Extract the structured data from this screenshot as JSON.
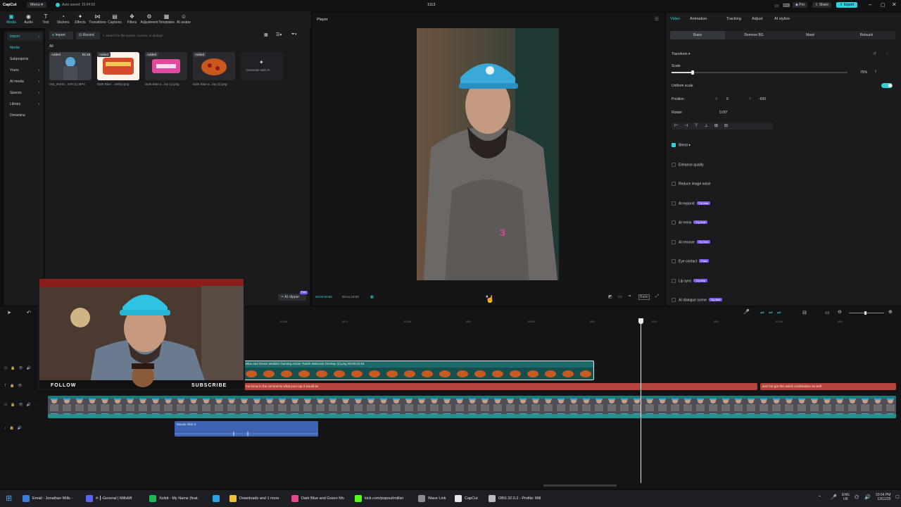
{
  "titlebar": {
    "app_name": "CapCut",
    "menu_label": "Menu",
    "autosave": "Auto saved: 15:04:02",
    "project_name": "1113",
    "pro_label": "Pro",
    "share_label": "Share",
    "export_label": "Export"
  },
  "toolbar": [
    {
      "label": "Media",
      "icon": "media-icon"
    },
    {
      "label": "Audio",
      "icon": "audio-icon"
    },
    {
      "label": "Text",
      "icon": "text-icon"
    },
    {
      "label": "Stickers",
      "icon": "stickers-icon"
    },
    {
      "label": "Effects",
      "icon": "effects-icon"
    },
    {
      "label": "Transitions",
      "icon": "transitions-icon"
    },
    {
      "label": "Captions",
      "icon": "captions-icon"
    },
    {
      "label": "Filters",
      "icon": "filters-icon"
    },
    {
      "label": "Adjustment",
      "icon": "adjustment-icon"
    },
    {
      "label": "Templates",
      "icon": "templates-icon"
    },
    {
      "label": "AI avatar",
      "icon": "ai-avatar-icon"
    }
  ],
  "leftnav": {
    "import": "Import",
    "media": "Media",
    "subprojects": "Subprojects",
    "yours": "Yours",
    "ai_media": "AI media",
    "spaces": "Spaces",
    "library": "Library",
    "dreamina": "Dreamina"
  },
  "media": {
    "import_button": "Import",
    "record_button": "Record",
    "search_placeholder": "Search for file names, scenes, or dialogs",
    "filter_all": "All",
    "items": [
      {
        "badge": "Added",
        "duration": "01:18",
        "name": "Out_20231...079 (1).MP4"
      },
      {
        "badge": "Added",
        "duration": "",
        "name": "Dark Blue ...verlay.png"
      },
      {
        "badge": "Added",
        "duration": "",
        "name": "Dark Blue a...lay (1).png"
      },
      {
        "badge": "Added",
        "duration": "",
        "name": "Dark Blue a...lay (2).png"
      }
    ],
    "generate_label": "Generate with AI",
    "ai_clipper": "AI clipper",
    "ai_clipper_badge": "Free"
  },
  "player": {
    "title": "Player",
    "current_time": "00:00:50:55",
    "total_time": "00:01:16:50",
    "overlay_number": "3",
    "ratio_label": "Ratio"
  },
  "props": {
    "tabs": [
      "Video",
      "Animation",
      "Tracking",
      "Adjust",
      "AI stylize"
    ],
    "subtabs": [
      "Basic",
      "Remove BG",
      "Mask",
      "Retouch"
    ],
    "transform": "Transform",
    "scale": "Scale",
    "scale_value": "75%",
    "scale_fraction": 0.75,
    "uniform_scale": "Uniform scale",
    "position": "Position",
    "pos_x_label": "X",
    "pos_x": "0",
    "pos_y_label": "Y",
    "pos_y": "-600",
    "rotate": "Rotate",
    "rotate_value": "0.00°",
    "blend": "Blend",
    "enhance_quality": "Enhance quality",
    "reduce_noise": "Reduce image noise",
    "ai_expand": "AI expand",
    "ai_remix": "AI remix",
    "ai_remove": "AI remove",
    "eye_contact": "Eye contact",
    "lip_sync": "Lip sync",
    "ai_dialogue": "AI dialogue scene",
    "try_free": "Try free",
    "free": "Free"
  },
  "timeline": {
    "ruler": [
      "00:40",
      "|00:f",
      "00:40",
      "|00f",
      "00:50",
      "|00f",
      "00:0",
      "|00f",
      "01:00",
      "|00f"
    ],
    "overlay_clip": "Blue and Green Modern Gaming Action Twitch Webcam Overlay (2).png  00:00:02:04",
    "caption_clip_1": "me know in the comments what your top 3 would be",
    "caption_clip_2": "and I've got this weird combination as well",
    "audio_clip": "Mouse click 4",
    "webcam_follow": "FOLLOW",
    "webcam_subscribe": "SUBSCRIBE"
  },
  "taskbar": {
    "items": [
      {
        "label": "Email - Jonathan Mills -",
        "color": "#3a7bd5"
      },
      {
        "label": "#-┃-General | MillsMf",
        "color": "#5865f2"
      },
      {
        "label": "Xzibit - My Name (feat.",
        "color": "#1db954"
      },
      {
        "label": "",
        "color": "#2aa3e0"
      },
      {
        "label": "Downloads and 1 more",
        "color": "#f0c040"
      },
      {
        "label": "Dark Blue and Green Mo",
        "color": "#e04a8a"
      },
      {
        "label": "kick.com/popout/millsn",
        "color": "#53fc18"
      },
      {
        "label": "Wave Link",
        "color": "#8a8a90"
      },
      {
        "label": "CapCut",
        "color": "#e8e8e8"
      },
      {
        "label": "OBS 32.0.2 - Profile: Mill",
        "color": "#bbbbbb"
      }
    ],
    "lang": "ENG",
    "region": "UK",
    "time": "03:04 PM",
    "date": "13/11/25"
  },
  "colors": {
    "accent": "#2fd0d8",
    "overlay_clip": "#1c6b6a",
    "caption_clip": "#b5463f",
    "video_track": "#1e7a78",
    "audio_clip": "#3d64b3",
    "pink_number": "#e0449a"
  }
}
